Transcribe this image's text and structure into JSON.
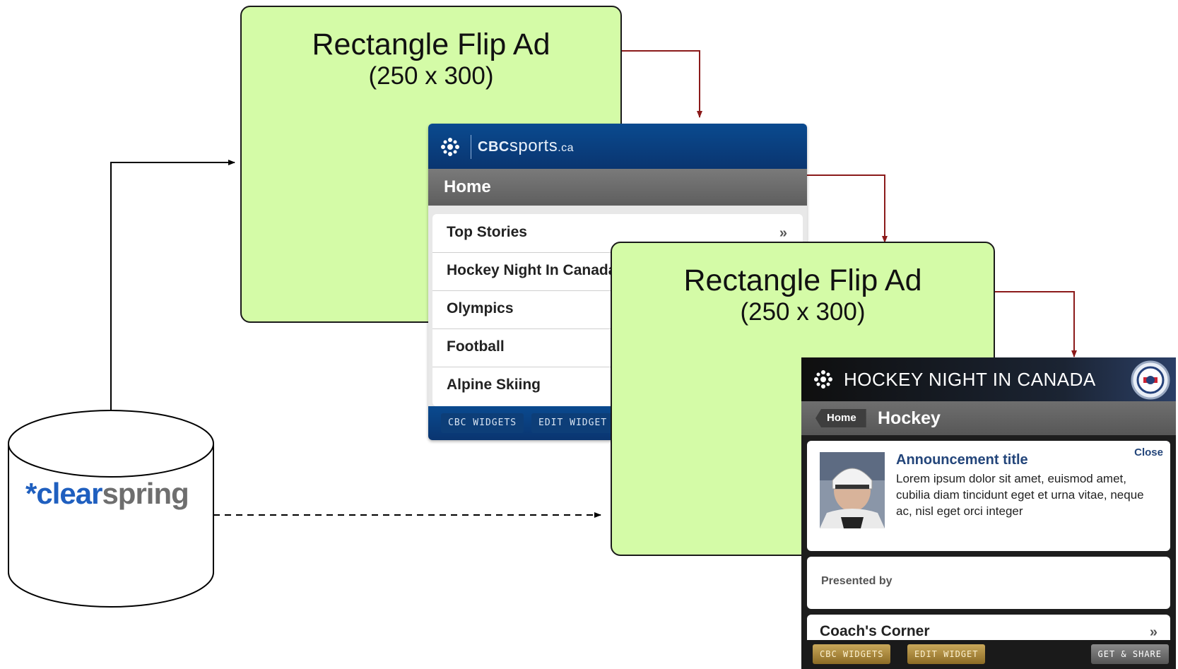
{
  "ad_top": {
    "title": "Rectangle Flip Ad",
    "size": "(250 x 300)"
  },
  "ad_mid": {
    "title": "Rectangle Flip Ad",
    "size": "(250 x 300)"
  },
  "cbc_widget": {
    "brand_cbc": "CBC",
    "brand_sports": "sports",
    "brand_domain": ".ca",
    "home_label": "Home",
    "items": [
      {
        "label": "Top Stories"
      },
      {
        "label": "Hockey Night In Canada"
      },
      {
        "label": "Olympics"
      },
      {
        "label": "Football"
      },
      {
        "label": "Alpine Skiing"
      }
    ],
    "chevron": "»",
    "footer": {
      "widgets": "CBC WIDGETS",
      "edit": "EDIT WIDGET"
    }
  },
  "hnic_widget": {
    "title": "HOCKEY NIGHT IN CANADA",
    "back_label": "Home",
    "section": "Hockey",
    "announcement": {
      "title": "Announcement title",
      "close": "Close",
      "body": "Lorem ipsum dolor sit amet, euismod amet, cubilia diam tincidunt eget et urna vitae, neque ac, nisl eget orci integer"
    },
    "presented_by": "Presented by",
    "coach": "Coach's Corner",
    "chevron": "»",
    "footer": {
      "widgets": "CBC WIDGETS",
      "edit": "EDIT WIDGET",
      "share": "GET & SHARE"
    }
  },
  "clearspring": {
    "asterisk": "*",
    "clear": "clear",
    "spring": "spring",
    "colors": {
      "brand_blue": "#1f5fbf",
      "grey": "#6e6e6e"
    }
  },
  "colors": {
    "ad_fill": "#d4fba7",
    "arrow_red": "#8b1a1a",
    "cbc_blue": "#0a3f80"
  }
}
